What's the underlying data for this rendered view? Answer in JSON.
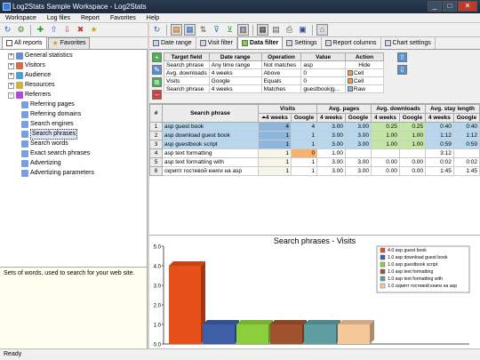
{
  "window": {
    "title": "Log2Stats Sample Workspace - Log2Stats"
  },
  "menu": [
    "Workspace",
    "Log files",
    "Report",
    "Favorites",
    "Help"
  ],
  "left_tabs": [
    "All reports",
    "Favorites"
  ],
  "tree": [
    {
      "label": "General statistics",
      "level": 0,
      "expander": "+",
      "icon": "chart-icon",
      "color": "#6a8fd0"
    },
    {
      "label": "Visitors",
      "level": 0,
      "expander": "+",
      "icon": "people-icon",
      "color": "#d0704a"
    },
    {
      "label": "Audience",
      "level": 0,
      "expander": "+",
      "icon": "globe-icon",
      "color": "#4aa0d0"
    },
    {
      "label": "Resources",
      "level": 0,
      "expander": "+",
      "icon": "folder-icon",
      "color": "#d0b04a"
    },
    {
      "label": "Referrers",
      "level": 0,
      "expander": "-",
      "icon": "link-icon",
      "color": "#b04ad0"
    },
    {
      "label": "Referring pages",
      "level": 1,
      "icon": "page-icon",
      "color": "#7a9fe0"
    },
    {
      "label": "Referring domains",
      "level": 1,
      "icon": "domain-icon",
      "color": "#7a9fe0"
    },
    {
      "label": "Search engines",
      "level": 1,
      "icon": "search-engine-icon",
      "color": "#7a9fe0"
    },
    {
      "label": "Search phrases",
      "level": 1,
      "icon": "search-phrase-icon",
      "color": "#7a9fe0",
      "selected": true
    },
    {
      "label": "Search words",
      "level": 1,
      "icon": "search-word-icon",
      "color": "#7a9fe0"
    },
    {
      "label": "Exact search phrases",
      "level": 1,
      "icon": "exact-phrase-icon",
      "color": "#7a9fe0"
    },
    {
      "label": "Advertizing",
      "level": 1,
      "icon": "ad-icon",
      "color": "#7a9fe0"
    },
    {
      "label": "Advertizing parameters",
      "level": 1,
      "icon": "ad-param-icon",
      "color": "#7a9fe0"
    }
  ],
  "description": "Sets of words, used to search for your web site.",
  "status": "Ready",
  "report_tabs": [
    {
      "label": "Date range",
      "icon": "calendar-icon"
    },
    {
      "label": "Visit filter",
      "icon": "funnel-icon"
    },
    {
      "label": "Data filter",
      "icon": "data-filter-icon",
      "active": true
    },
    {
      "label": "Settings",
      "icon": "settings-icon"
    },
    {
      "label": "Report columns",
      "icon": "columns-icon"
    },
    {
      "label": "Chart settings",
      "icon": "chart-settings-icon"
    }
  ],
  "filter": {
    "headers": [
      "Target field",
      "Date range",
      "Operation",
      "Value",
      "Action"
    ],
    "rows": [
      {
        "field": "Search phrase",
        "date": "Any time range",
        "op": "Not matches",
        "value": "asp",
        "action": "Hide",
        "chip": ""
      },
      {
        "field": "Avg. downloads",
        "date": "4 weeks",
        "op": "Above",
        "value": "0",
        "action": "Cell",
        "chip": "#f0a040"
      },
      {
        "field": "Visits",
        "date": "Google",
        "op": "Equals",
        "value": "0",
        "action": "Cell",
        "chip": "#f0a040"
      },
      {
        "field": "Search phrase",
        "date": "4 weeks",
        "op": "Matches",
        "value": "guestbook|g...",
        "action": "Raw",
        "chip": "#8cb6dc"
      }
    ]
  },
  "grid": {
    "group_headers": [
      "Visits",
      "Avg. pages",
      "Avg. downloads",
      "Avg. stay length"
    ],
    "col_hash": "#",
    "col_phrase": "Search phrase",
    "sub_headers": [
      "4 weeks",
      "Google",
      "4 weeks",
      "Google",
      "4 weeks",
      "Google",
      "4 weeks",
      "Google"
    ],
    "rows": [
      {
        "n": "1",
        "phrase": "asp guest book",
        "v": [
          "4",
          "4",
          "3.00",
          "3.00",
          "0.25",
          "0.25",
          "0:40",
          "0:40"
        ],
        "sel": true
      },
      {
        "n": "2",
        "phrase": "asp download guest book",
        "v": [
          "1",
          "1",
          "3.00",
          "3.00",
          "1.00",
          "1.00",
          "1:12",
          "1:12"
        ],
        "sel": true
      },
      {
        "n": "3",
        "phrase": "asp guestbook script",
        "v": [
          "1",
          "1",
          "3.00",
          "3.00",
          "1.00",
          "1.00",
          "0:59",
          "0:59"
        ],
        "sel": true
      },
      {
        "n": "4",
        "phrase": "asp text formatting",
        "v": [
          "1",
          "0",
          "1.00",
          "",
          "",
          "",
          "3:12",
          ""
        ]
      },
      {
        "n": "5",
        "phrase": "asp text formatting with",
        "v": [
          "1",
          "1",
          "3.00",
          "3.00",
          "0.00",
          "0.00",
          "0:02",
          "0:02"
        ]
      },
      {
        "n": "6",
        "phrase": "скрипт гостевой книги на asp",
        "v": [
          "1",
          "1",
          "3.00",
          "3.00",
          "0.00",
          "0.00",
          "1:45",
          "1:45"
        ]
      }
    ]
  },
  "chart_data": {
    "type": "bar",
    "title": "Search phrases - Visits",
    "categories": [
      "asp guest book",
      "asp download guest book",
      "asp guestbook script",
      "asp text formatting",
      "asp text formatting with",
      "скрипт гостевой книги на asp"
    ],
    "values": [
      4,
      1,
      1,
      1,
      1,
      1
    ],
    "colors": [
      "#e8501a",
      "#3e5ea8",
      "#8ccf3c",
      "#a0522d",
      "#5f9ea0",
      "#f5c89a"
    ],
    "legend_labels": [
      "4.0 asp guest book",
      "1.0 asp download guest book",
      "1.0 asp guestbook script",
      "1.0 asp text formatting",
      "1.0 asp text formatting with",
      "1.0 скрипт гостевой книги на asp"
    ],
    "yticks": [
      "0.0",
      "1.0",
      "2.0",
      "3.0",
      "4.0",
      "5.0"
    ],
    "ylim": [
      0,
      5
    ],
    "legend": "top-right",
    "grid": false
  }
}
